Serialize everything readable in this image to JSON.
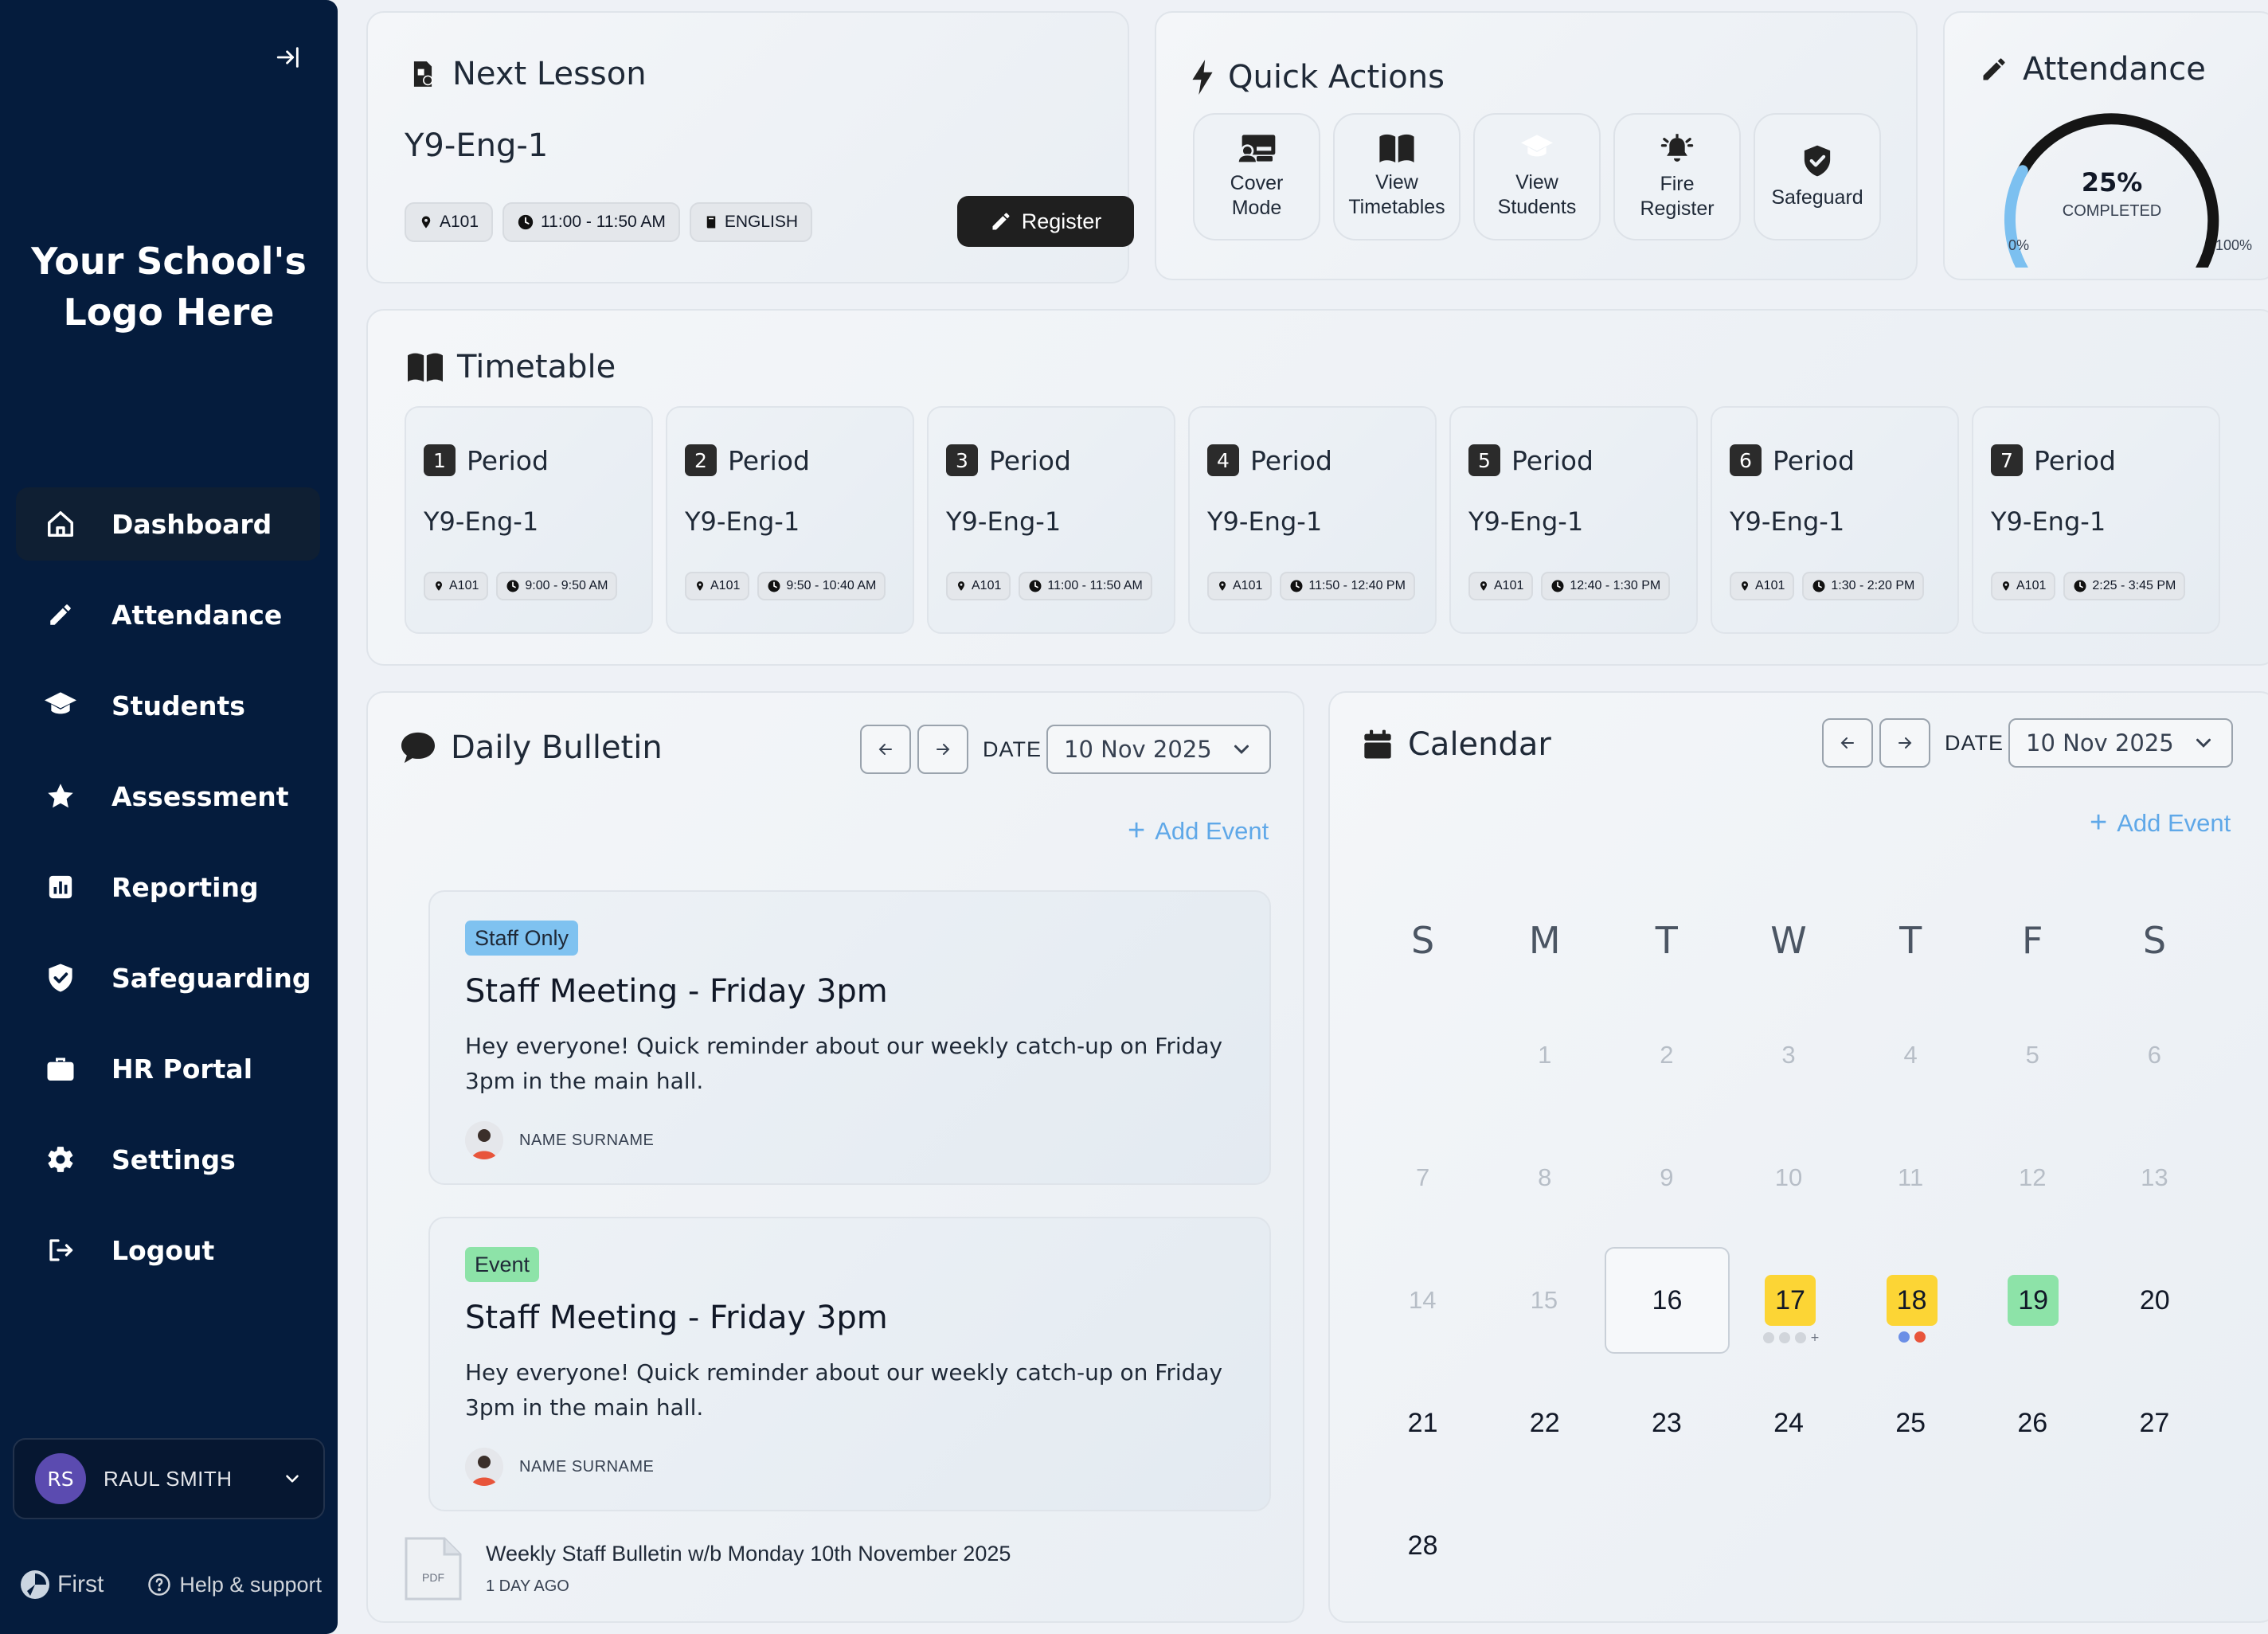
{
  "sidebar": {
    "logo_line1": "Your School's",
    "logo_line2": "Logo Here",
    "nav": [
      {
        "label": "Dashboard",
        "icon": "home-icon",
        "active": true
      },
      {
        "label": "Attendance",
        "icon": "pencil-icon"
      },
      {
        "label": "Students",
        "icon": "graduation-cap-icon"
      },
      {
        "label": "Assessment",
        "icon": "star-icon"
      },
      {
        "label": "Reporting",
        "icon": "bar-chart-icon"
      },
      {
        "label": "Safeguarding",
        "icon": "shield-icon"
      },
      {
        "label": "HR Portal",
        "icon": "briefcase-icon"
      },
      {
        "label": "Settings",
        "icon": "gear-icon"
      },
      {
        "label": "Logout",
        "icon": "logout-icon"
      }
    ],
    "user": {
      "initials": "RS",
      "name": "RAUL SMITH"
    },
    "brand": "First",
    "help": "Help & support"
  },
  "next_lesson": {
    "title": "Next Lesson",
    "class": "Y9-Eng-1",
    "room": "A101",
    "time": "11:00 - 11:50 AM",
    "subject": "ENGLISH",
    "register_label": "Register"
  },
  "quick_actions": {
    "title": "Quick Actions",
    "items": [
      {
        "label": "Cover\nMode",
        "icon": "cover-mode-icon"
      },
      {
        "label": "View\nTimetables",
        "icon": "book-open-icon"
      },
      {
        "label": "View\nStudents",
        "icon": "graduation-cap-icon"
      },
      {
        "label": "Fire\nRegister",
        "icon": "alarm-bell-icon"
      },
      {
        "label": "Safeguard",
        "icon": "shield-check-icon"
      }
    ]
  },
  "attendance": {
    "title": "Attendance",
    "percent_label": "25%",
    "completed_label": "COMPLETED",
    "min_label": "0%",
    "max_label": "100%",
    "fraction": 0.25,
    "colors": {
      "fill": "#7cc0f0",
      "track": "#151515"
    }
  },
  "timetable": {
    "title": "Timetable",
    "periods": [
      {
        "num": "1",
        "label": "Period",
        "class": "Y9-Eng-1",
        "room": "A101",
        "time": "9:00 - 9:50 AM"
      },
      {
        "num": "2",
        "label": "Period",
        "class": "Y9-Eng-1",
        "room": "A101",
        "time": "9:50 - 10:40 AM"
      },
      {
        "num": "3",
        "label": "Period",
        "class": "Y9-Eng-1",
        "room": "A101",
        "time": "11:00 - 11:50 AM"
      },
      {
        "num": "4",
        "label": "Period",
        "class": "Y9-Eng-1",
        "room": "A101",
        "time": "11:50 - 12:40 PM"
      },
      {
        "num": "5",
        "label": "Period",
        "class": "Y9-Eng-1",
        "room": "A101",
        "time": "12:40 - 1:30 PM"
      },
      {
        "num": "6",
        "label": "Period",
        "class": "Y9-Eng-1",
        "room": "A101",
        "time": "1:30 - 2:20 PM"
      },
      {
        "num": "7",
        "label": "Period",
        "class": "Y9-Eng-1",
        "room": "A101",
        "time": "2:25 - 3:45 PM"
      }
    ]
  },
  "bulletin": {
    "title": "Daily Bulletin",
    "date_label": "DATE",
    "date_value": "10 Nov 2025",
    "add_event": "Add Event",
    "posts": [
      {
        "tag": "Staff Only",
        "tag_type": "staff",
        "title": "Staff Meeting - Friday 3pm",
        "body": "Hey everyone! Quick reminder about our weekly catch-up on Friday 3pm in the main hall.",
        "author": "NAME SURNAME"
      },
      {
        "tag": "Event",
        "tag_type": "event",
        "title": "Staff Meeting - Friday 3pm",
        "body": "Hey everyone! Quick reminder about our weekly catch-up on Friday 3pm in the main hall.",
        "author": "NAME SURNAME"
      }
    ],
    "attachment": {
      "type": "PDF",
      "name": "Weekly Staff Bulletin w/b Monday 10th November 2025",
      "age": "1 DAY AGO"
    }
  },
  "calendar": {
    "title": "Calendar",
    "date_label": "DATE",
    "date_value": "10 Nov 2025",
    "add_event": "Add Event",
    "weekdays": [
      "S",
      "M",
      "T",
      "W",
      "T",
      "F",
      "S"
    ],
    "weeks": [
      [
        {
          "d": ""
        },
        {
          "d": "1",
          "muted": true
        },
        {
          "d": "2",
          "muted": true
        },
        {
          "d": "3",
          "muted": true
        },
        {
          "d": "4",
          "muted": true
        },
        {
          "d": "5",
          "muted": true
        },
        {
          "d": "6",
          "muted": true
        }
      ],
      [
        {
          "d": "7",
          "muted": true
        },
        {
          "d": "8",
          "muted": true
        },
        {
          "d": "9",
          "muted": true
        },
        {
          "d": "10",
          "muted": true
        },
        {
          "d": "11",
          "muted": true
        },
        {
          "d": "12",
          "muted": true
        },
        {
          "d": "13",
          "muted": true
        }
      ],
      [
        {
          "d": "14",
          "muted": true
        },
        {
          "d": "15",
          "muted": true
        },
        {
          "d": "16",
          "today": true
        },
        {
          "d": "17",
          "highlight": "#fcd535",
          "dots": [
            "#d1d5db",
            "#d1d5db",
            "#d1d5db"
          ],
          "more": "+"
        },
        {
          "d": "18",
          "highlight": "#fcd535",
          "dots": [
            "#6b8fe6",
            "#e8553b"
          ]
        },
        {
          "d": "19",
          "highlight": "#8de3a8"
        },
        {
          "d": "20"
        }
      ],
      [
        {
          "d": "21"
        },
        {
          "d": "22"
        },
        {
          "d": "23"
        },
        {
          "d": "24"
        },
        {
          "d": "25"
        },
        {
          "d": "26"
        },
        {
          "d": "27"
        }
      ],
      [
        {
          "d": "28"
        },
        {
          "d": ""
        },
        {
          "d": ""
        },
        {
          "d": ""
        },
        {
          "d": ""
        },
        {
          "d": ""
        },
        {
          "d": ""
        }
      ]
    ]
  }
}
